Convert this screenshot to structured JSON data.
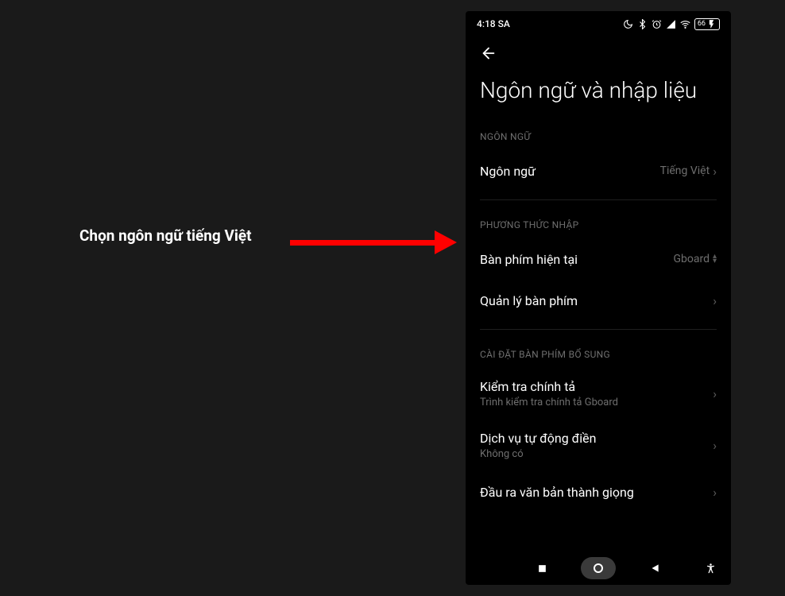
{
  "annotation": {
    "text": "Chọn ngôn ngữ tiếng Việt"
  },
  "statusBar": {
    "time": "4:18 SA",
    "battery": "66"
  },
  "pageTitle": "Ngôn ngữ và nhập liệu",
  "sections": {
    "language": {
      "header": "NGÔN NGỮ",
      "item": {
        "label": "Ngôn ngữ",
        "value": "Tiếng Việt"
      }
    },
    "inputMethod": {
      "header": "PHƯƠNG THỨC NHẬP",
      "currentKeyboard": {
        "label": "Bàn phím hiện tại",
        "value": "Gboard"
      },
      "manageKeyboards": {
        "label": "Quản lý bàn phím"
      }
    },
    "additional": {
      "header": "CÀI ĐẶT BÀN PHÍM BỔ SUNG",
      "spellCheck": {
        "label": "Kiểm tra chính tả",
        "sublabel": "Trình kiểm tra chính tả Gboard"
      },
      "autofill": {
        "label": "Dịch vụ tự động điền",
        "sublabel": "Không có"
      },
      "tts": {
        "label": "Đầu ra văn bản thành giọng"
      }
    }
  }
}
